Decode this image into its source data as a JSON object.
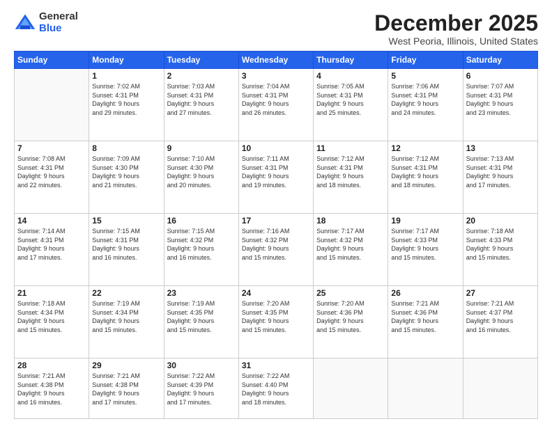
{
  "header": {
    "logo": {
      "line1": "General",
      "line2": "Blue"
    },
    "title": "December 2025",
    "location": "West Peoria, Illinois, United States"
  },
  "days_of_week": [
    "Sunday",
    "Monday",
    "Tuesday",
    "Wednesday",
    "Thursday",
    "Friday",
    "Saturday"
  ],
  "weeks": [
    [
      {
        "day": "",
        "info": ""
      },
      {
        "day": "1",
        "info": "Sunrise: 7:02 AM\nSunset: 4:31 PM\nDaylight: 9 hours\nand 29 minutes."
      },
      {
        "day": "2",
        "info": "Sunrise: 7:03 AM\nSunset: 4:31 PM\nDaylight: 9 hours\nand 27 minutes."
      },
      {
        "day": "3",
        "info": "Sunrise: 7:04 AM\nSunset: 4:31 PM\nDaylight: 9 hours\nand 26 minutes."
      },
      {
        "day": "4",
        "info": "Sunrise: 7:05 AM\nSunset: 4:31 PM\nDaylight: 9 hours\nand 25 minutes."
      },
      {
        "day": "5",
        "info": "Sunrise: 7:06 AM\nSunset: 4:31 PM\nDaylight: 9 hours\nand 24 minutes."
      },
      {
        "day": "6",
        "info": "Sunrise: 7:07 AM\nSunset: 4:31 PM\nDaylight: 9 hours\nand 23 minutes."
      }
    ],
    [
      {
        "day": "7",
        "info": "Sunrise: 7:08 AM\nSunset: 4:31 PM\nDaylight: 9 hours\nand 22 minutes."
      },
      {
        "day": "8",
        "info": "Sunrise: 7:09 AM\nSunset: 4:30 PM\nDaylight: 9 hours\nand 21 minutes."
      },
      {
        "day": "9",
        "info": "Sunrise: 7:10 AM\nSunset: 4:30 PM\nDaylight: 9 hours\nand 20 minutes."
      },
      {
        "day": "10",
        "info": "Sunrise: 7:11 AM\nSunset: 4:31 PM\nDaylight: 9 hours\nand 19 minutes."
      },
      {
        "day": "11",
        "info": "Sunrise: 7:12 AM\nSunset: 4:31 PM\nDaylight: 9 hours\nand 18 minutes."
      },
      {
        "day": "12",
        "info": "Sunrise: 7:12 AM\nSunset: 4:31 PM\nDaylight: 9 hours\nand 18 minutes."
      },
      {
        "day": "13",
        "info": "Sunrise: 7:13 AM\nSunset: 4:31 PM\nDaylight: 9 hours\nand 17 minutes."
      }
    ],
    [
      {
        "day": "14",
        "info": "Sunrise: 7:14 AM\nSunset: 4:31 PM\nDaylight: 9 hours\nand 17 minutes."
      },
      {
        "day": "15",
        "info": "Sunrise: 7:15 AM\nSunset: 4:31 PM\nDaylight: 9 hours\nand 16 minutes."
      },
      {
        "day": "16",
        "info": "Sunrise: 7:15 AM\nSunset: 4:32 PM\nDaylight: 9 hours\nand 16 minutes."
      },
      {
        "day": "17",
        "info": "Sunrise: 7:16 AM\nSunset: 4:32 PM\nDaylight: 9 hours\nand 15 minutes."
      },
      {
        "day": "18",
        "info": "Sunrise: 7:17 AM\nSunset: 4:32 PM\nDaylight: 9 hours\nand 15 minutes."
      },
      {
        "day": "19",
        "info": "Sunrise: 7:17 AM\nSunset: 4:33 PM\nDaylight: 9 hours\nand 15 minutes."
      },
      {
        "day": "20",
        "info": "Sunrise: 7:18 AM\nSunset: 4:33 PM\nDaylight: 9 hours\nand 15 minutes."
      }
    ],
    [
      {
        "day": "21",
        "info": "Sunrise: 7:18 AM\nSunset: 4:34 PM\nDaylight: 9 hours\nand 15 minutes."
      },
      {
        "day": "22",
        "info": "Sunrise: 7:19 AM\nSunset: 4:34 PM\nDaylight: 9 hours\nand 15 minutes."
      },
      {
        "day": "23",
        "info": "Sunrise: 7:19 AM\nSunset: 4:35 PM\nDaylight: 9 hours\nand 15 minutes."
      },
      {
        "day": "24",
        "info": "Sunrise: 7:20 AM\nSunset: 4:35 PM\nDaylight: 9 hours\nand 15 minutes."
      },
      {
        "day": "25",
        "info": "Sunrise: 7:20 AM\nSunset: 4:36 PM\nDaylight: 9 hours\nand 15 minutes."
      },
      {
        "day": "26",
        "info": "Sunrise: 7:21 AM\nSunset: 4:36 PM\nDaylight: 9 hours\nand 15 minutes."
      },
      {
        "day": "27",
        "info": "Sunrise: 7:21 AM\nSunset: 4:37 PM\nDaylight: 9 hours\nand 16 minutes."
      }
    ],
    [
      {
        "day": "28",
        "info": "Sunrise: 7:21 AM\nSunset: 4:38 PM\nDaylight: 9 hours\nand 16 minutes."
      },
      {
        "day": "29",
        "info": "Sunrise: 7:21 AM\nSunset: 4:38 PM\nDaylight: 9 hours\nand 17 minutes."
      },
      {
        "day": "30",
        "info": "Sunrise: 7:22 AM\nSunset: 4:39 PM\nDaylight: 9 hours\nand 17 minutes."
      },
      {
        "day": "31",
        "info": "Sunrise: 7:22 AM\nSunset: 4:40 PM\nDaylight: 9 hours\nand 18 minutes."
      },
      {
        "day": "",
        "info": ""
      },
      {
        "day": "",
        "info": ""
      },
      {
        "day": "",
        "info": ""
      }
    ]
  ]
}
